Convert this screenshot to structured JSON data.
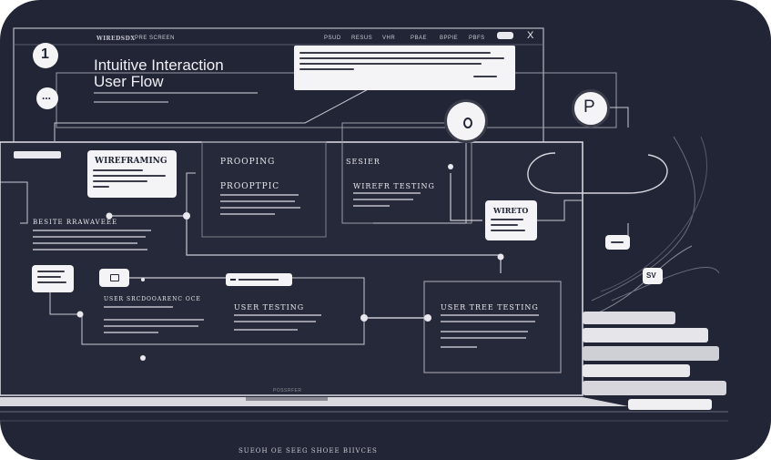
{
  "window": {
    "brand": "WIREDSDX",
    "subtitle": "PRE SCREEN",
    "nav": [
      "PSUD",
      "RESUS",
      "VHR",
      "PBAE",
      "BPPIE",
      "PBFS"
    ],
    "close_glyph": "X"
  },
  "header": {
    "step_number": "1",
    "title_line1": "Intuitive Interaction",
    "title_line2": "User Flow",
    "more_glyph": "..."
  },
  "nodes": {
    "wireframing": "WIREFRAMING",
    "prototyping_header": "PROOPING",
    "prototyping": "PROOPTPIC",
    "sketch": "SESIER",
    "wireframe_testing": "WIREFR TESTING",
    "wireframe_panel": "BESITE RRAWAVEEE",
    "user_research": "USER SRCDOOARENC OCE",
    "user_testing": "USER TESTING",
    "usability_testing": "USER TREE TESTING",
    "wireto": "WIRETO",
    "p_badge": "P",
    "sv_badge": "SV",
    "laptop_label": "POSSRFER",
    "caption": "SUEOH OE SEEG SHOEE BIIVCES"
  },
  "colors": {
    "background": "#222536",
    "line": "#c9c9d2",
    "card": "#f4f4f6",
    "panel_border": "#9a9aa6"
  }
}
